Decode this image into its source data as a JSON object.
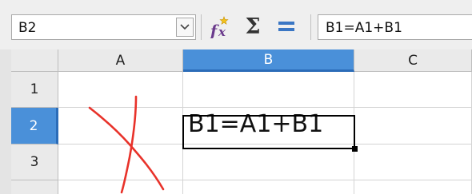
{
  "name_box": {
    "value": "B2"
  },
  "formula_bar": {
    "value": "B1=A1+B1"
  },
  "toolbar": {
    "function_wizard_icon": "function-wizard-icon",
    "sum_icon": "sigma-icon",
    "sum_glyph": "Σ",
    "formula_icon": "equals-icon",
    "formula_glyph": "="
  },
  "columns": [
    "A",
    "B",
    "C"
  ],
  "rows": [
    "1",
    "2",
    "3"
  ],
  "active_cell": "B2",
  "cells": {
    "B2": "B1=A1+B1"
  },
  "colors": {
    "header_active": "#4a90d9",
    "annotation_stroke": "#e8322a"
  }
}
